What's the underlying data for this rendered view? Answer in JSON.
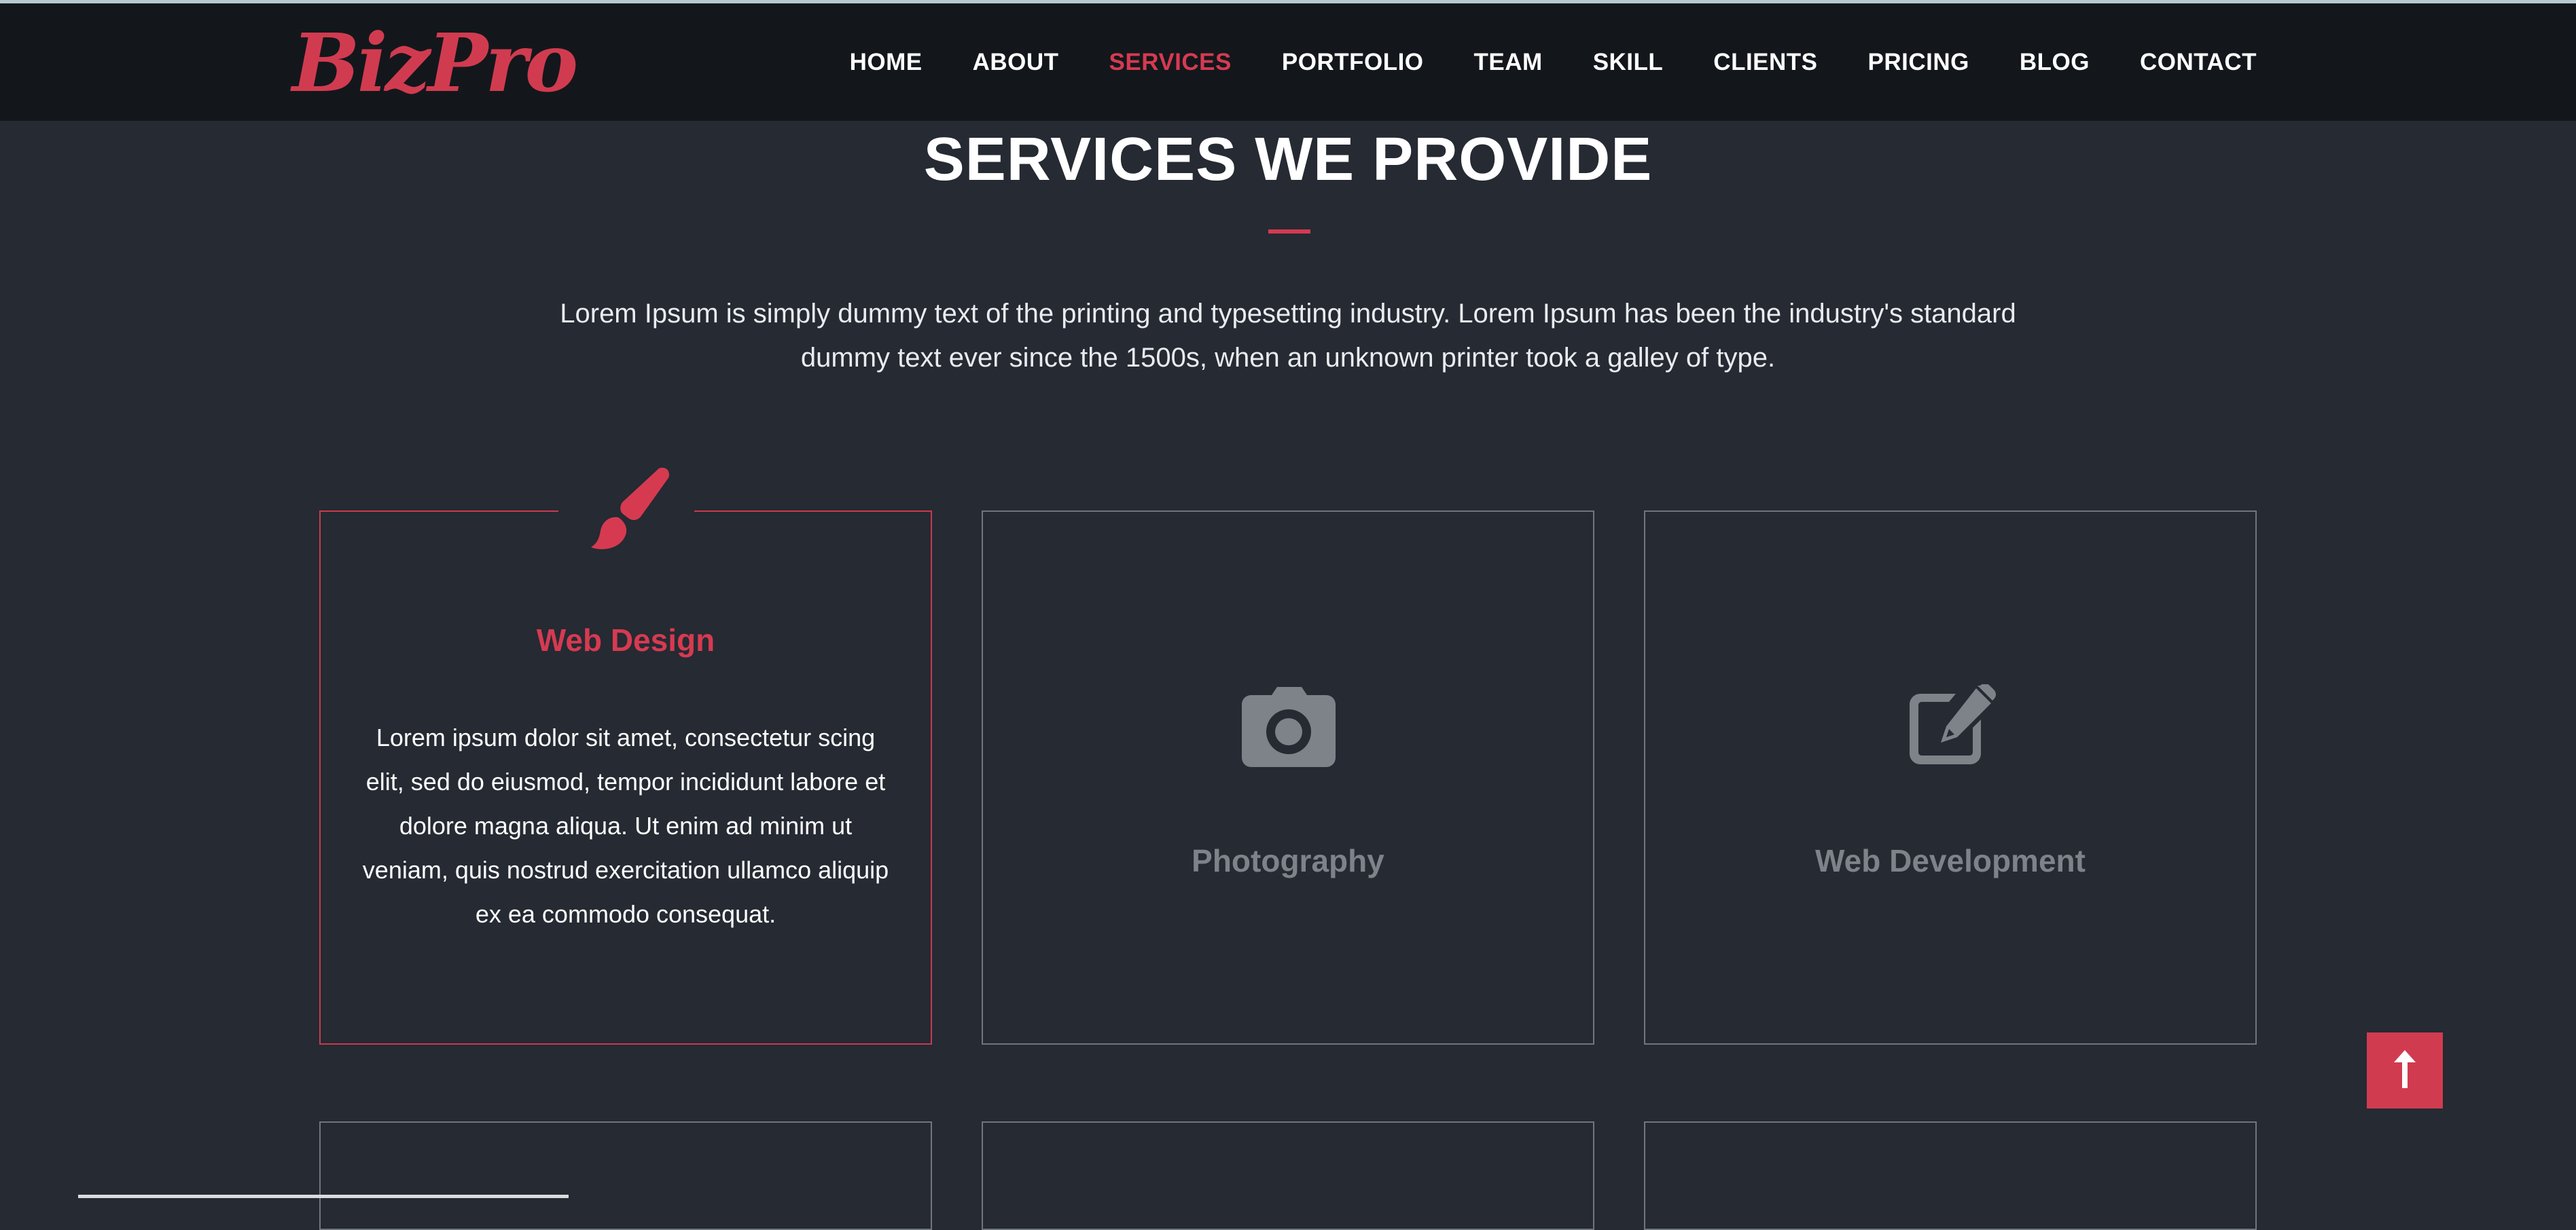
{
  "brand": {
    "logo_text": "BizPro"
  },
  "nav": {
    "items": [
      {
        "label": "HOME"
      },
      {
        "label": "ABOUT"
      },
      {
        "label": "SERVICES",
        "active": true
      },
      {
        "label": "PORTFOLIO"
      },
      {
        "label": "TEAM"
      },
      {
        "label": "SKILL"
      },
      {
        "label": "CLIENTS"
      },
      {
        "label": "PRICING"
      },
      {
        "label": "BLOG"
      },
      {
        "label": "CONTACT"
      }
    ]
  },
  "section": {
    "title": "SERVICES WE PROVIDE",
    "intro": "Lorem Ipsum is simply dummy text of the printing and typesetting industry. Lorem Ipsum has been the industry's standard dummy text ever since the 1500s, when an unknown printer took a galley of type."
  },
  "services": [
    {
      "title": "Web Design",
      "icon": "paint-brush-icon",
      "text": "Lorem ipsum dolor sit amet, consectetur scing elit, sed do eiusmod, tempor incididunt labore et dolore magna aliqua. Ut enim ad minim ut veniam, quis nostrud exercitation ullamco aliquip ex ea commodo consequat.",
      "active": true
    },
    {
      "title": "Photography",
      "icon": "camera-icon"
    },
    {
      "title": "Web Development",
      "icon": "edit-icon"
    }
  ],
  "colors": {
    "accent": "#d63a51",
    "background": "#252a33",
    "navbar": "#13171c",
    "muted": "#7d8389"
  },
  "back_to_top": {
    "icon": "arrow-up-icon"
  }
}
